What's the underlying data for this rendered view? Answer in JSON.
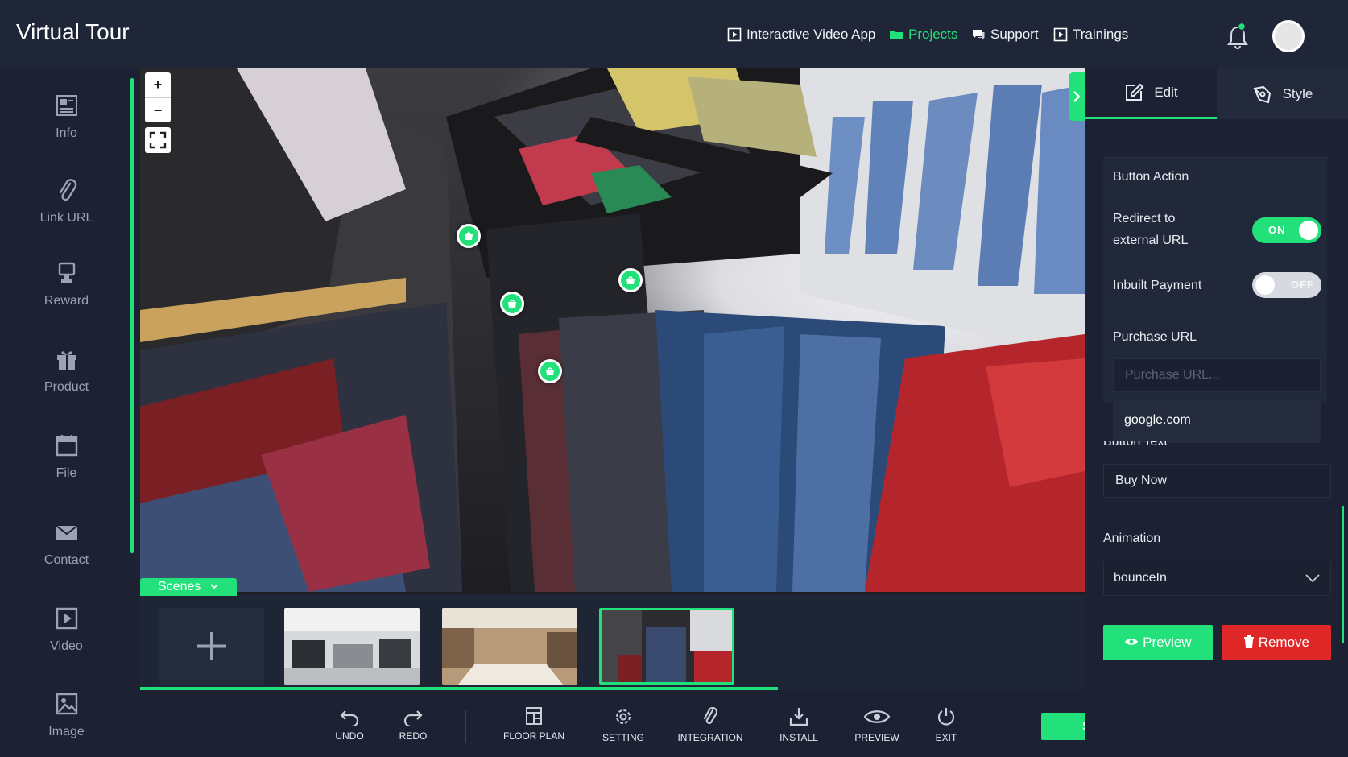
{
  "app": {
    "title": "Virtual Tour"
  },
  "nav": [
    {
      "label": "Interactive Video App",
      "icon": "play-square-icon"
    },
    {
      "label": "Projects",
      "icon": "folder-icon",
      "active": true
    },
    {
      "label": "Support",
      "icon": "chat-icon"
    },
    {
      "label": "Trainings",
      "icon": "play-square-icon"
    }
  ],
  "sidebar": {
    "items": [
      {
        "label": "Info",
        "icon": "info-icon"
      },
      {
        "label": "Link URL",
        "icon": "paperclip-icon"
      },
      {
        "label": "Reward",
        "icon": "reward-icon"
      },
      {
        "label": "Product",
        "icon": "gift-icon"
      },
      {
        "label": "File",
        "icon": "calendar-file-icon"
      },
      {
        "label": "Contact",
        "icon": "envelope-icon"
      },
      {
        "label": "Video",
        "icon": "play-icon"
      },
      {
        "label": "Image",
        "icon": "image-icon"
      }
    ]
  },
  "viewer": {
    "zoom_in": "+",
    "zoom_out": "−"
  },
  "scenes": {
    "label": "Scenes",
    "add_label": "+",
    "progress": 0.67
  },
  "toolbar": {
    "undo": "UNDO",
    "redo": "REDO",
    "floor_plan": "FLOOR PLAN",
    "setting": "SETTING",
    "integration": "INTEGRATION",
    "install": "INSTALL",
    "preview": "PREVIEW",
    "exit": "EXIT",
    "save": "Save"
  },
  "panel": {
    "tabs": {
      "edit": "Edit",
      "style": "Style"
    },
    "button_action": "Button Action",
    "redirect_label_1": "Redirect to",
    "redirect_label_2": "external URL",
    "redirect_state": "ON",
    "inbuilt_payment": "Inbuilt Payment",
    "inbuilt_state": "OFF",
    "purchase_url_label": "Purchase URL",
    "purchase_url_placeholder": "Purchase URL...",
    "suggestion": "google.com",
    "button_text_label": "Button Text",
    "button_text_value": "Buy Now",
    "animation_label": "Animation",
    "animation_value": "bounceIn",
    "preview": "Preview",
    "remove": "Remove"
  },
  "colors": {
    "accent": "#22e07a",
    "danger": "#e02727",
    "background": "#1c2233"
  }
}
